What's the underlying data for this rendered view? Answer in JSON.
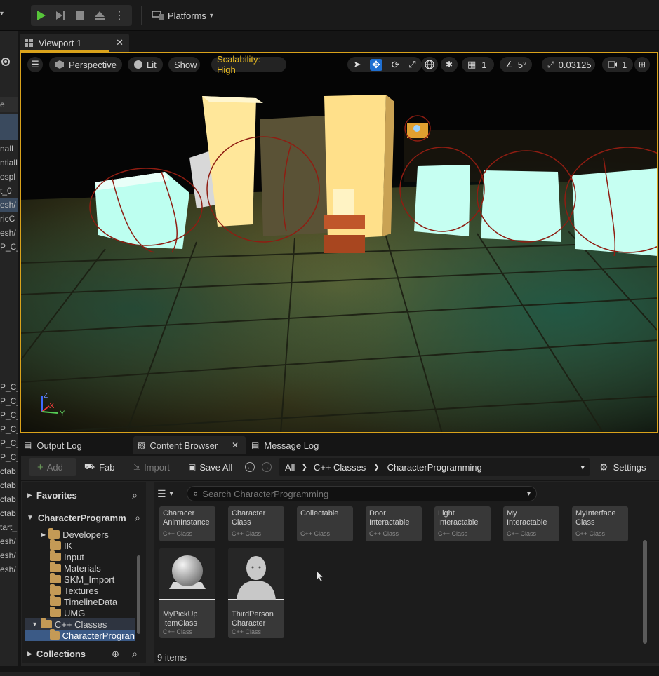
{
  "toolbar": {
    "platforms_label": "Platforms"
  },
  "outliner": {
    "rows": [
      "nalL",
      "ntialL",
      "ospl",
      "t_0",
      "esh/",
      "ricC",
      "esh/",
      "P_C_",
      "P_C_",
      "P_C_",
      "P_C_",
      "P_C_",
      "P_C_",
      "P_C_",
      "ctab",
      "ctab",
      "ctab",
      "ctab",
      "tart_",
      "esh/",
      "esh/",
      "esh/"
    ]
  },
  "tabs": {
    "viewport_tab": "Viewport 1"
  },
  "viewport": {
    "perspective_label": "Perspective",
    "lit_label": "Lit",
    "show_label": "Show",
    "scalability_label": "Scalability: High",
    "grid_value": "1",
    "angle_value": "5°",
    "scale_value": "0.03125",
    "camera_value": "1",
    "axis_x": "X",
    "axis_y": "Y",
    "axis_z": "Z"
  },
  "bottom_tabs": {
    "output_log": "Output Log",
    "content_browser": "Content Browser",
    "message_log": "Message Log"
  },
  "content_browser": {
    "add_label": "Add",
    "fab_label": "Fab",
    "import_label": "Import",
    "save_all_label": "Save All",
    "breadcrumb": [
      "All",
      "C++ Classes",
      "CharacterProgramming"
    ],
    "settings_label": "Settings",
    "search_placeholder": "Search CharacterProgramming",
    "favorites_label": "Favorites",
    "project_label": "CharacterProgramm",
    "collections_label": "Collections",
    "tree": [
      {
        "label": "Developers"
      },
      {
        "label": "IK"
      },
      {
        "label": "Input"
      },
      {
        "label": "Materials"
      },
      {
        "label": "SKM_Import"
      },
      {
        "label": "Textures"
      },
      {
        "label": "TimelineData"
      },
      {
        "label": "UMG"
      }
    ],
    "cpp_classes_label": "C++ Classes",
    "selected_folder_label": "CharacterProgran",
    "assets_row1": [
      {
        "name": "Characer AnimInstance",
        "type": "C++ Class"
      },
      {
        "name": "Character Class",
        "type": "C++ Class"
      },
      {
        "name": "Collectable",
        "type": "C++ Class"
      },
      {
        "name": "Door Interactable",
        "type": "C++ Class"
      },
      {
        "name": "Light Interactable",
        "type": "C++ Class"
      },
      {
        "name": "My Interactable",
        "type": "C++ Class"
      },
      {
        "name": "MyInterface Class",
        "type": "C++ Class"
      }
    ],
    "assets_row2": [
      {
        "name": "MyPickUp ItemClass",
        "type": "C++ Class"
      },
      {
        "name": "ThirdPerson Character",
        "type": "C++ Class"
      }
    ],
    "item_count": "9 items"
  }
}
